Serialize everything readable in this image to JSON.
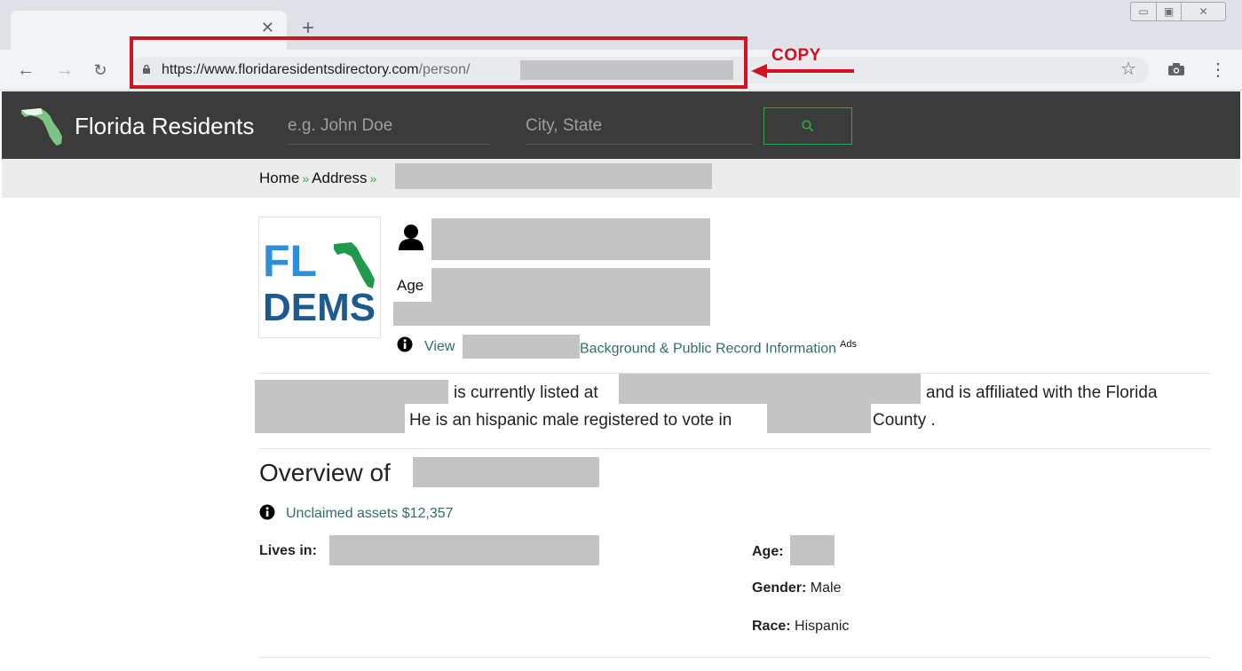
{
  "browser": {
    "url_host": "https://www.floridaresidentsdirectory.com",
    "url_path": "/person/",
    "annotation_label": "COPY"
  },
  "site": {
    "title": "Florida Residents",
    "name_placeholder": "e.g. John Doe",
    "location_placeholder": "City, State"
  },
  "breadcrumb": {
    "home": "Home",
    "address": "Address",
    "separator": "»"
  },
  "profile": {
    "logo_line1": "FL",
    "logo_line2": "DEMS",
    "age_label": "Age",
    "view_label": "View",
    "background_link": "Background & Public Record Information",
    "ads_label": "Ads"
  },
  "summary": {
    "listed_at": "is currently listed at",
    "affiliated": "and is affiliated with the Florida",
    "registered": "He is an hispanic male registered to vote in",
    "county": "County ."
  },
  "overview": {
    "heading": "Overview of",
    "unclaimed": "Unclaimed assets $12,357",
    "lives_in_label": "Lives in:",
    "age_label": "Age:",
    "gender_label": "Gender:",
    "gender_value": "Male",
    "race_label": "Race:",
    "race_value": "Hispanic"
  },
  "colors": {
    "nav_bg": "#3b3b3b",
    "accent_green": "#3aa546",
    "link_teal": "#2f6f66",
    "annotation_red": "#cf1424"
  }
}
